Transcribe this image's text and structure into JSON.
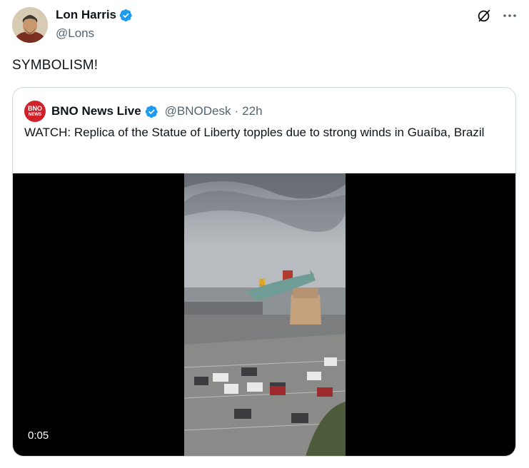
{
  "author": {
    "name": "Lon Harris",
    "handle": "@Lons"
  },
  "post": {
    "text": "SYMBOLISM!"
  },
  "icons": {
    "verified": "verified-badge-icon",
    "grok": "grok-icon",
    "more": "more-icon"
  },
  "quoted": {
    "avatar_line1": "BNO",
    "avatar_line2": "NEWS",
    "name": "BNO News Live",
    "handle": "@BNODesk",
    "separator": "·",
    "time": "22h",
    "text": "WATCH: Replica of the Statue of Liberty topples due to strong winds in Guaíba, Brazil",
    "video_time": "0:05"
  },
  "colors": {
    "verified": "#1d9bf0",
    "text": "#0f1419",
    "secondary": "#536471",
    "border": "#cfd9de",
    "bno_red": "#d0212b"
  }
}
